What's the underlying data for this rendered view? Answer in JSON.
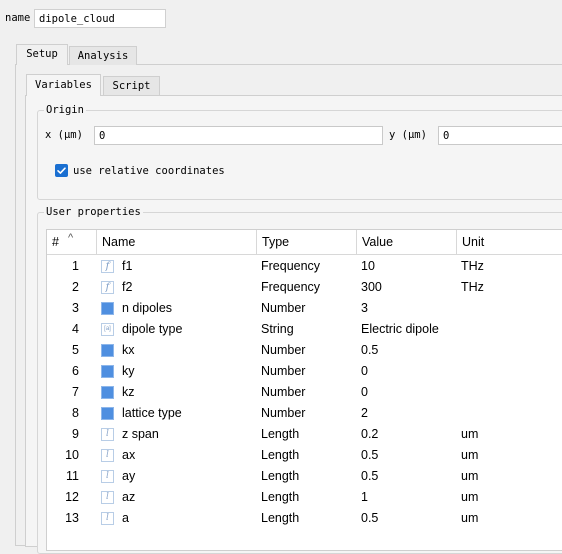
{
  "name_label": "name",
  "name_value": "dipole_cloud",
  "outer_tabs": [
    {
      "label": "Setup"
    },
    {
      "label": "Analysis"
    }
  ],
  "inner_tabs": [
    {
      "label": "Variables"
    },
    {
      "label": "Script"
    }
  ],
  "origin": {
    "title": "Origin",
    "x_label": "x (μm)",
    "x_value": "0",
    "y_label": "y (μm)",
    "y_value": "0",
    "relative_label": "use relative coordinates",
    "relative_checked": true
  },
  "user_properties": {
    "title": "User properties",
    "columns": [
      "#",
      "Name",
      "Type",
      "Value",
      "Unit"
    ],
    "rows": [
      {
        "num": "1",
        "icon": "function-icon",
        "name": "f1",
        "type": "Frequency",
        "value": "10",
        "unit": "THz"
      },
      {
        "num": "2",
        "icon": "function-icon",
        "name": "f2",
        "type": "Frequency",
        "value": "300",
        "unit": "THz"
      },
      {
        "num": "3",
        "icon": "number-icon",
        "name": "n dipoles",
        "type": "Number",
        "value": "3",
        "unit": ""
      },
      {
        "num": "4",
        "icon": "string-icon",
        "name": "dipole type",
        "type": "String",
        "value": "Electric dipole",
        "unit": ""
      },
      {
        "num": "5",
        "icon": "number-icon",
        "name": "kx",
        "type": "Number",
        "value": "0.5",
        "unit": ""
      },
      {
        "num": "6",
        "icon": "number-icon",
        "name": "ky",
        "type": "Number",
        "value": "0",
        "unit": ""
      },
      {
        "num": "7",
        "icon": "number-icon",
        "name": "kz",
        "type": "Number",
        "value": "0",
        "unit": ""
      },
      {
        "num": "8",
        "icon": "number-icon",
        "name": "lattice type",
        "type": "Number",
        "value": "2",
        "unit": ""
      },
      {
        "num": "9",
        "icon": "length-icon",
        "name": "z span",
        "type": "Length",
        "value": "0.2",
        "unit": "um"
      },
      {
        "num": "10",
        "icon": "length-icon",
        "name": "ax",
        "type": "Length",
        "value": "0.5",
        "unit": "um"
      },
      {
        "num": "11",
        "icon": "length-icon",
        "name": "ay",
        "type": "Length",
        "value": "0.5",
        "unit": "um"
      },
      {
        "num": "12",
        "icon": "length-icon",
        "name": "az",
        "type": "Length",
        "value": "1",
        "unit": "um"
      },
      {
        "num": "13",
        "icon": "length-icon",
        "name": "a",
        "type": "Length",
        "value": "0.5",
        "unit": "um"
      }
    ]
  },
  "colors": {
    "checkbox_accent": "#1a6fd1",
    "number_icon": "#4f8fe0"
  }
}
